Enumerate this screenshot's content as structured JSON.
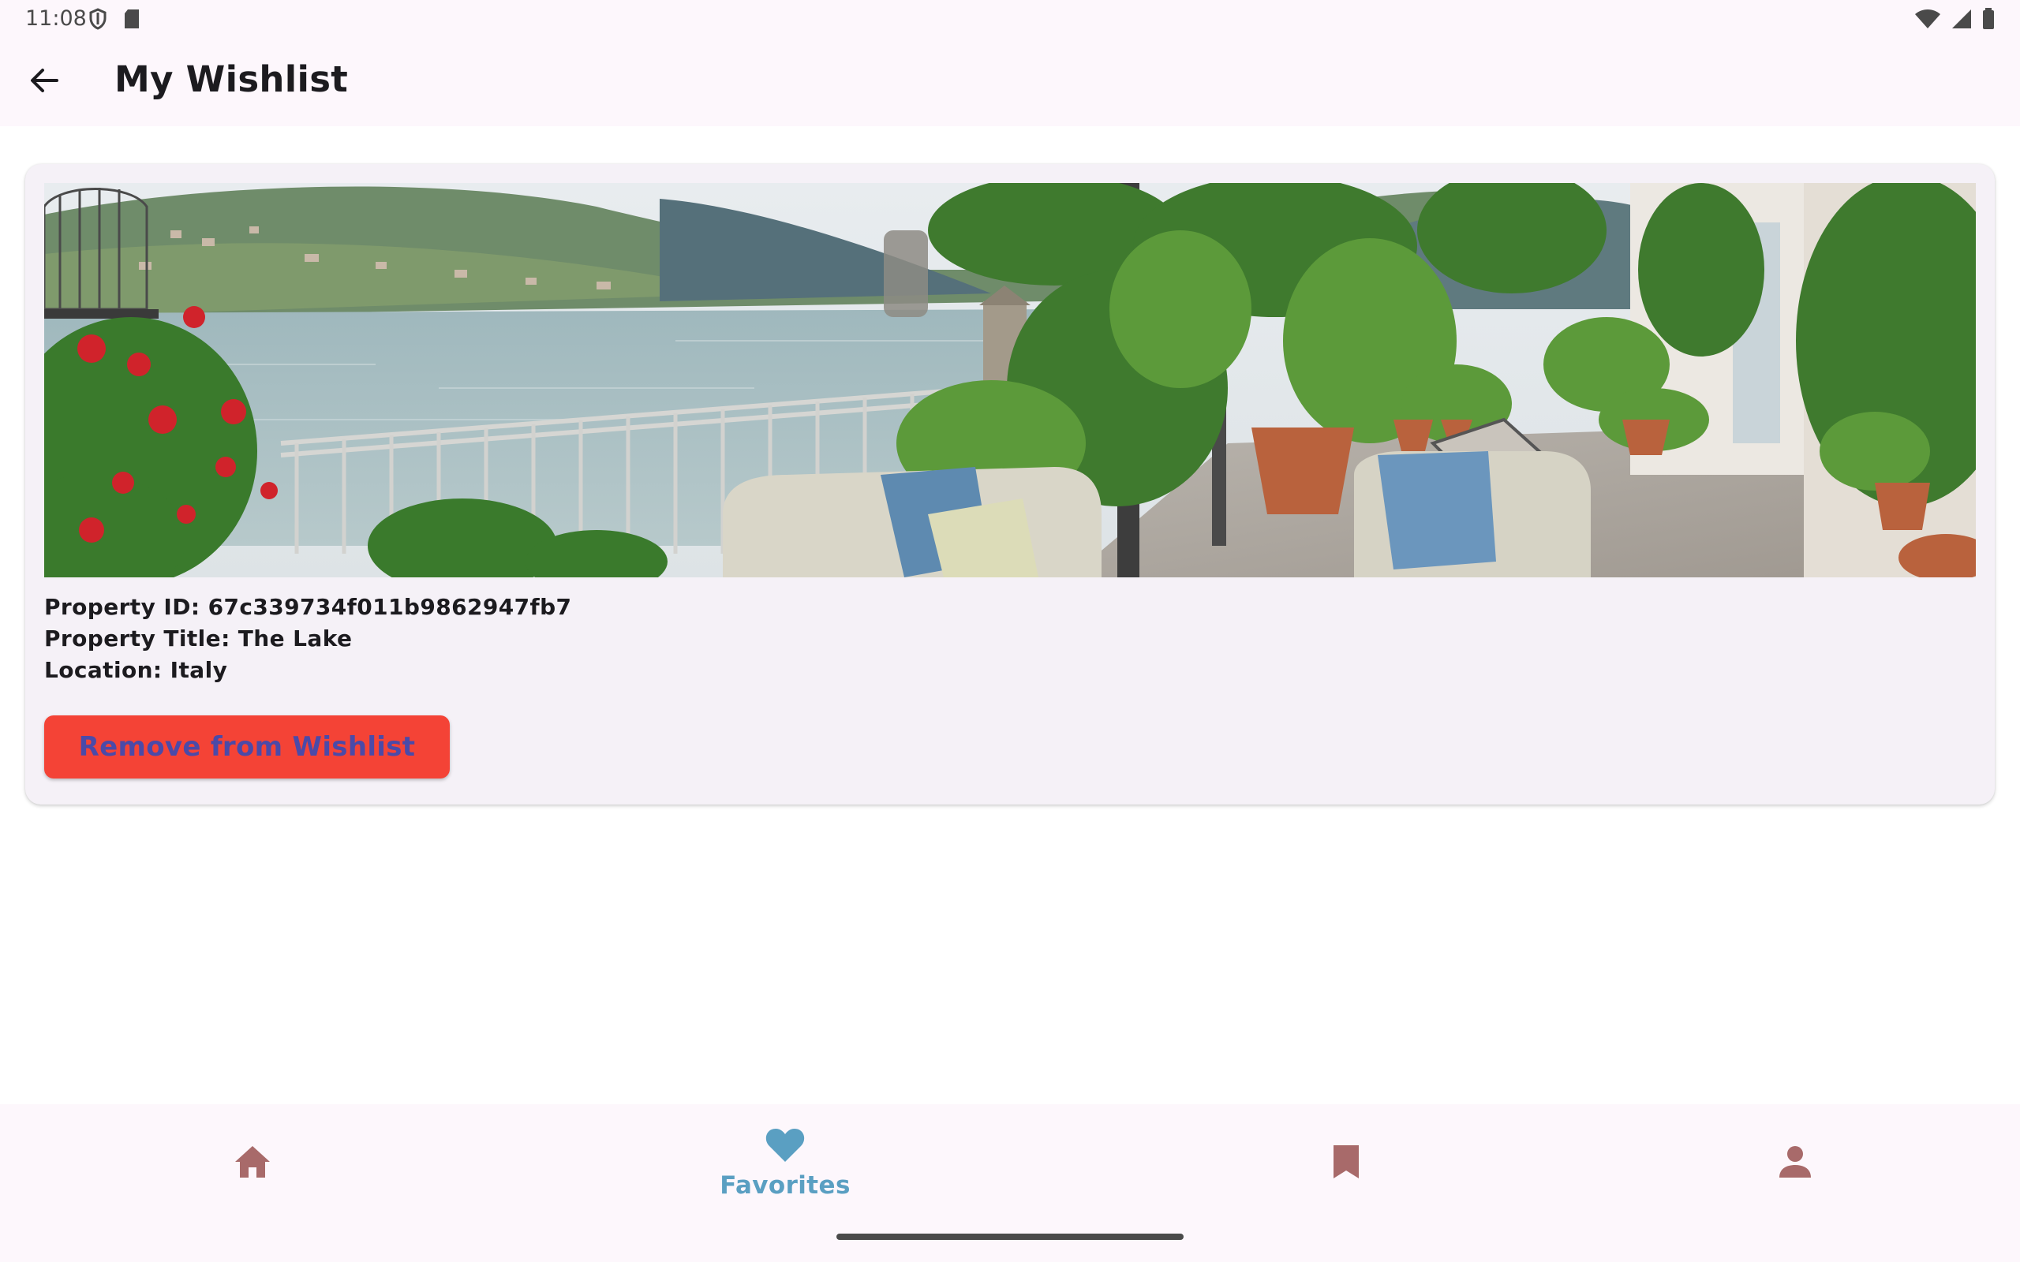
{
  "status_bar": {
    "time": "11:08",
    "left_icons": [
      "shield-icon",
      "sd-card-icon"
    ],
    "right_icons": [
      "wifi-icon",
      "cell-signal-icon",
      "battery-icon"
    ]
  },
  "app_bar": {
    "title": "My Wishlist",
    "back_icon": "arrow-back-icon"
  },
  "wishlist": {
    "items": [
      {
        "image_alt": "Lakeside terrace with garden and sofas",
        "id_line": "Property ID: 67c339734f011b9862947fb7",
        "title_line": "Property Title: The Lake",
        "location_line": "Location: Italy",
        "remove_label": "Remove from Wishlist"
      }
    ]
  },
  "bottom_nav": {
    "items": [
      {
        "icon": "home-icon",
        "label": "",
        "active": false
      },
      {
        "icon": "heart-icon",
        "label": "Favorites",
        "active": true
      },
      {
        "icon": "bookmark-icon",
        "label": "",
        "active": false
      },
      {
        "icon": "person-icon",
        "label": "",
        "active": false
      }
    ]
  },
  "colors": {
    "accent_active": "#5a9fc2",
    "nav_inactive": "#a86a6a",
    "remove_button_bg": "#f44336",
    "remove_button_text": "#4b4aa8",
    "card_bg": "#f5f1f7",
    "bar_bg": "#fdf7fc"
  }
}
